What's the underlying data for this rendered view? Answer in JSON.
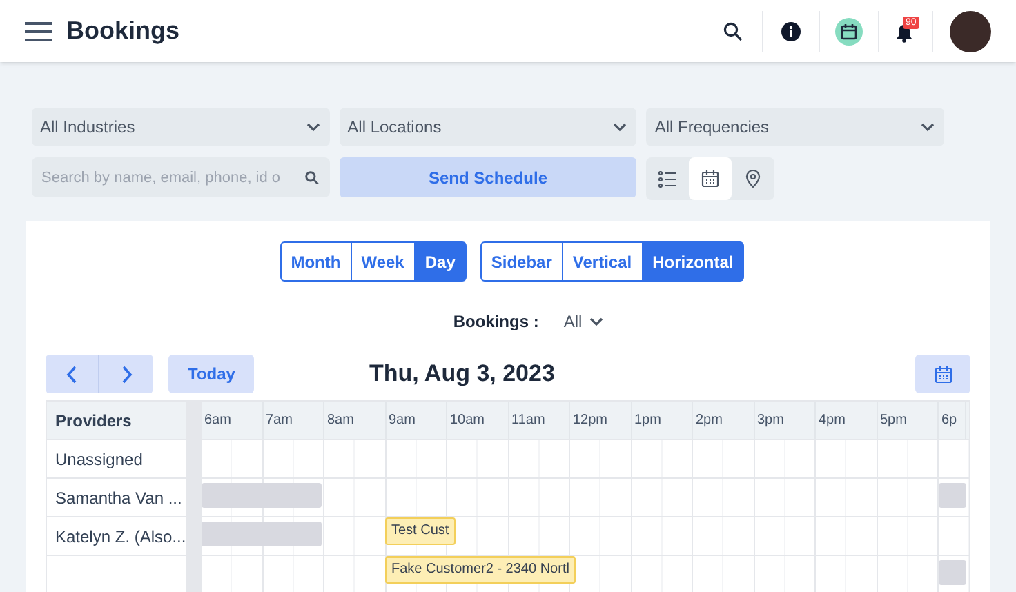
{
  "header": {
    "title": "Bookings",
    "notification_count": "90"
  },
  "filters": [
    {
      "value": "All Industries"
    },
    {
      "value": "All Locations"
    },
    {
      "value": "All Frequencies"
    }
  ],
  "search": {
    "placeholder": "Search by name, email, phone, id o"
  },
  "send_button": "Send Schedule",
  "view_modes": [
    {
      "kind": "list",
      "selected": false
    },
    {
      "kind": "calendar",
      "selected": true
    },
    {
      "kind": "map",
      "selected": false
    }
  ],
  "range_tabs": [
    {
      "label": "Month",
      "selected": false
    },
    {
      "label": "Week",
      "selected": false
    },
    {
      "label": "Day",
      "selected": true
    }
  ],
  "layout_tabs": [
    {
      "label": "Sidebar",
      "selected": false
    },
    {
      "label": "Vertical",
      "selected": false
    },
    {
      "label": "Horizontal",
      "selected": true
    }
  ],
  "bookings_filter": {
    "label": "Bookings :",
    "value": "All"
  },
  "today_button": "Today",
  "date": "Thu, Aug 3, 2023",
  "timeline": {
    "column_header": "Providers",
    "hours": [
      "6am",
      "7am",
      "8am",
      "9am",
      "10am",
      "11am",
      "12pm",
      "1pm",
      "2pm",
      "3pm",
      "4pm",
      "5pm",
      "6p"
    ],
    "rows": [
      {
        "name": "Unassigned",
        "events": []
      },
      {
        "name": "Samantha Van ...",
        "events": [
          {
            "kind": "blocked"
          },
          {
            "kind": "blocked"
          }
        ]
      },
      {
        "name": "Katelyn Z. (Also...",
        "events": [
          {
            "kind": "blocked"
          },
          {
            "kind": "booking",
            "label": "Test Cust"
          }
        ]
      },
      {
        "events": [
          {
            "kind": "booking",
            "label": "Fake Customer2 - 2340 Nortl"
          },
          {
            "kind": "blocked"
          }
        ]
      }
    ]
  }
}
